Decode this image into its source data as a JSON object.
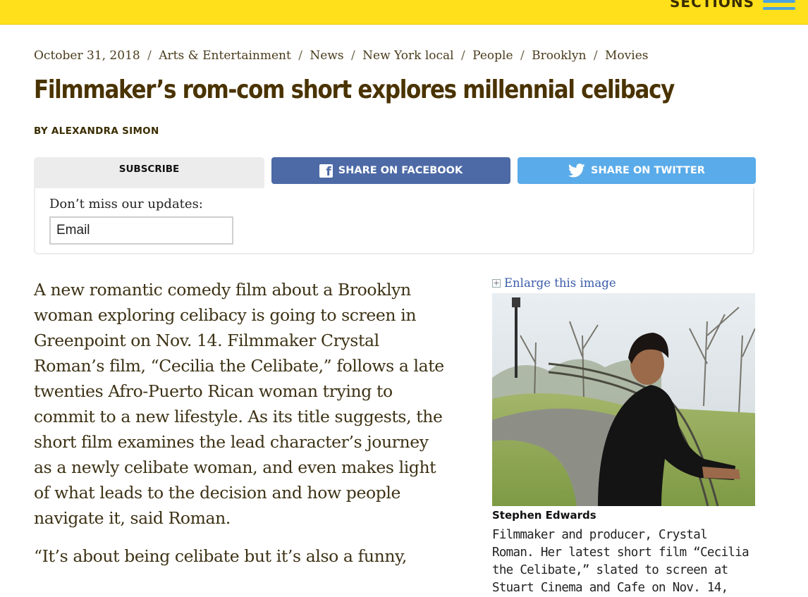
{
  "header": {
    "sections_label": "SECTIONS",
    "brand_color": "#ffe01b",
    "menu_icon": "hamburger-menu-icon"
  },
  "breadcrumb": {
    "date": "October 31, 2018",
    "separator": "/",
    "categories": [
      "Arts & Entertainment",
      "News",
      "New York local",
      "People",
      "Brooklyn",
      "Movies"
    ]
  },
  "article": {
    "headline": "Filmmaker’s rom-com short explores millennial celibacy",
    "byline": "BY ALEXANDRA SIMON",
    "paragraphs": [
      "A new romantic comedy film about a Brooklyn woman exploring celibacy is going to screen in Greenpoint on Nov. 14. Filmmaker Crystal Roman’s film, “Cecilia the Celibate,” follows a late twenties Afro-Puerto Rican woman trying to commit to a new lifestyle. As its title suggests, the short film examines the lead character’s journey as a newly celibate woman, and even makes light of what leads to the decision and how people navigate it, said Roman.",
      "“It’s about being celibate but it’s also a funny,"
    ]
  },
  "share": {
    "subscribe_label": "SUBSCRIBE",
    "facebook_label": "SHARE ON FACEBOOK",
    "twitter_label": "SHARE ON TWITTER",
    "facebook_color": "#4d6aa6",
    "twitter_color": "#5aabe9",
    "facebook_icon": "facebook-icon",
    "twitter_icon": "twitter-bird-icon"
  },
  "subscribe_box": {
    "prompt": "Don’t miss our updates:",
    "email_placeholder": "Email"
  },
  "image": {
    "enlarge_label": "Enlarge this image",
    "enlarge_icon": "enlarge-icon",
    "credit": "Stephen Edwards",
    "caption": "Filmmaker and producer, Crystal Roman. Her latest short film “Cecilia the Celibate,” slated to screen at Stuart Cinema and Cafe on Nov. 14,"
  }
}
